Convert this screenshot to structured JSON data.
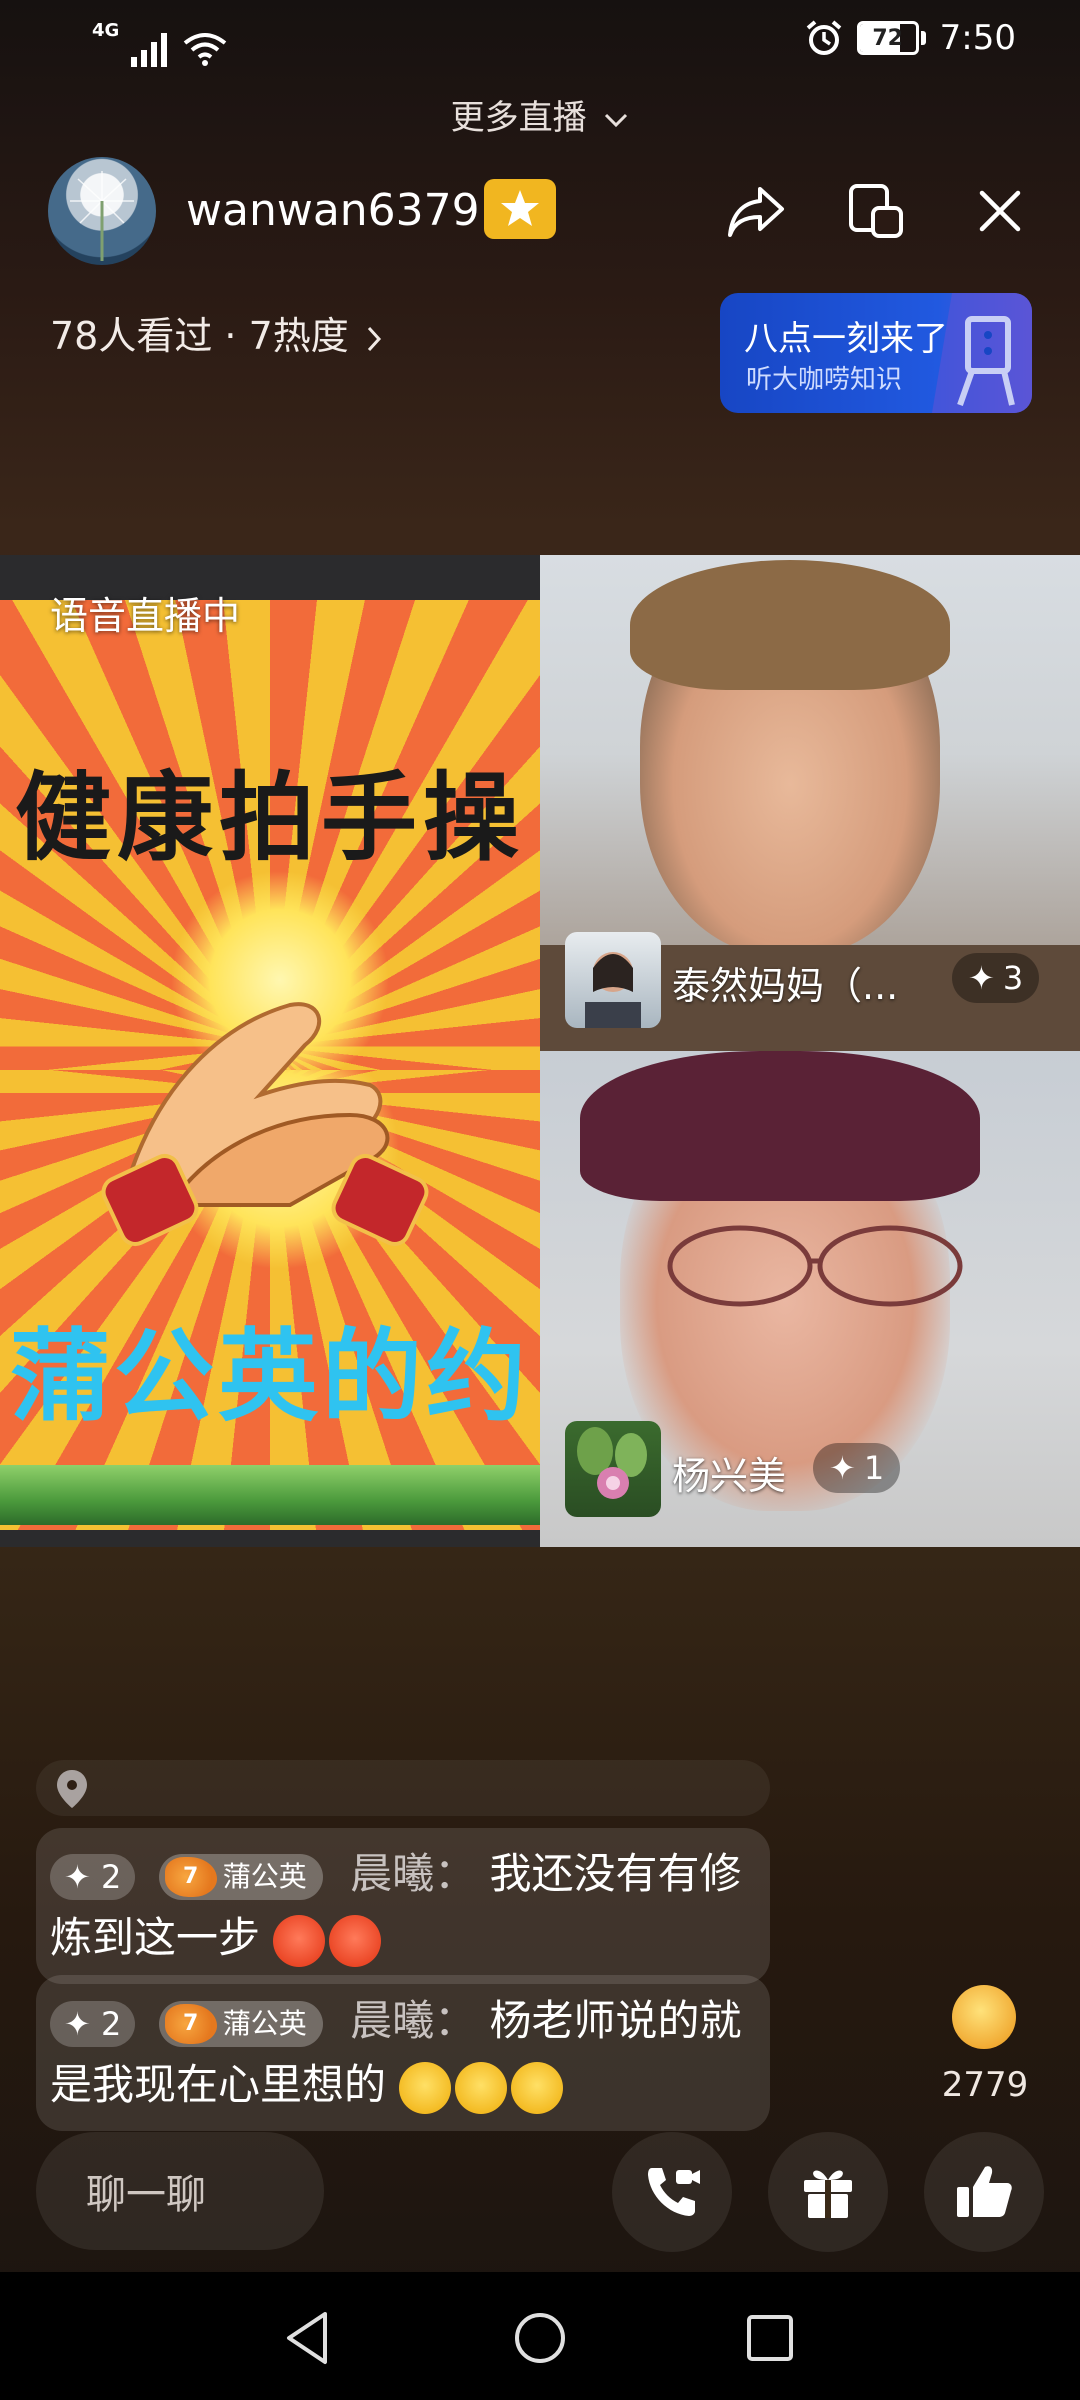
{
  "status_bar": {
    "network": "4G",
    "battery": "72",
    "battery_level": 0.72,
    "time": "7:50"
  },
  "top": {
    "more_live": "更多直播"
  },
  "host": {
    "username": "wanwan6379",
    "viewers_text": "78人看过 · 7热度"
  },
  "promo": {
    "title": "八点一刻来了",
    "subtitle": "听大咖唠知识"
  },
  "stream": {
    "voice_label": "语音直播中",
    "poster_title": "健康拍手操",
    "poster_subtitle": "蒲公英的约"
  },
  "guests": [
    {
      "name": "泰然妈妈（...",
      "score": "3"
    },
    {
      "name": "杨兴美",
      "score": "1"
    }
  ],
  "chat": [
    {
      "score": "2",
      "fan_level": "7",
      "fan_club": "蒲公英",
      "sender": "晨曦：",
      "text": "我还没有有修炼到这一步"
    },
    {
      "score": "2",
      "fan_level": "7",
      "fan_club": "蒲公英",
      "sender": "晨曦：",
      "text": "杨老师说的就是我现在心里想的"
    }
  ],
  "likes": {
    "count": "2779"
  },
  "bottom": {
    "chat_placeholder": "聊一聊"
  },
  "colors": {
    "promo_blue": "#2159e0",
    "badge_gold": "#f1b620",
    "poster_red": "#f26b3a",
    "poster_yellow": "#f5c033",
    "poster_cyan": "#2fc3f0"
  }
}
